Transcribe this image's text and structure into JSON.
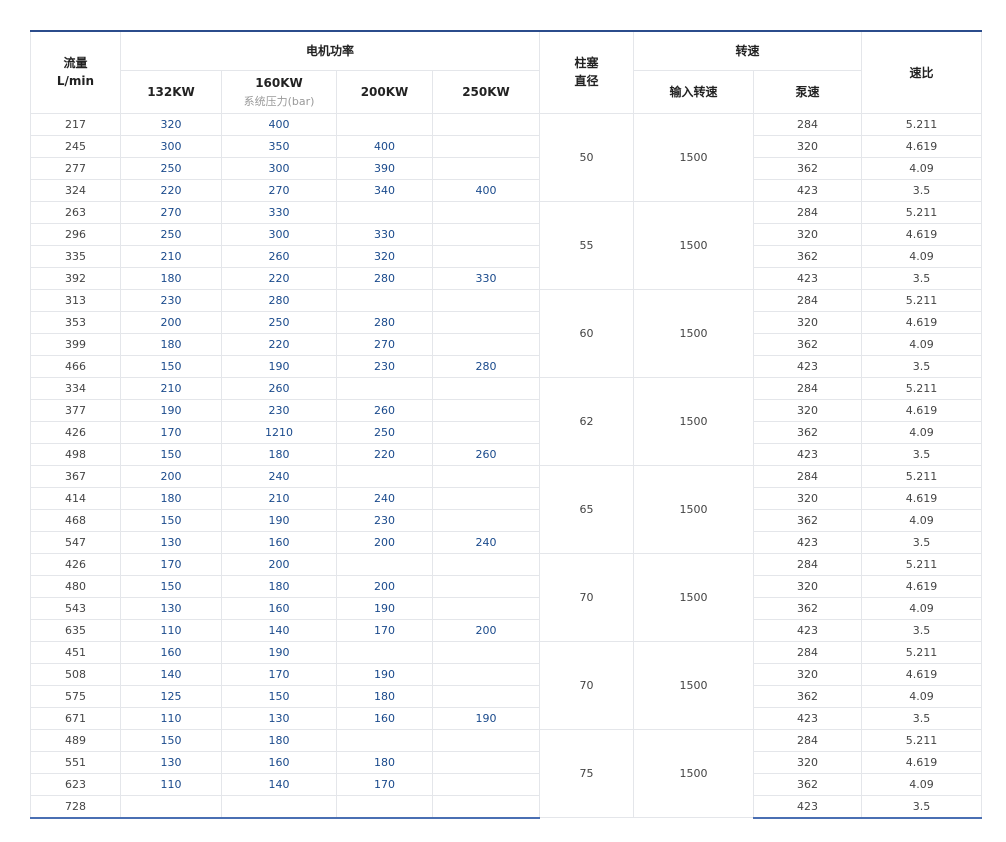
{
  "header": {
    "flow_label": "流量",
    "flow_unit": "L/min",
    "motor_power": "电机功率",
    "power_columns": [
      "132KW",
      "160KW",
      "200KW",
      "250KW"
    ],
    "pressure_caption": "系统压力(bar)",
    "plunger_label": "柱塞",
    "diameter_label": "直径",
    "speed_label": "转速",
    "input_speed": "输入转速",
    "pump_speed": "泵速",
    "ratio_label": "速比"
  },
  "groups": [
    {
      "diameter": "50",
      "input_speed": "1500",
      "rows": [
        {
          "flow": "217",
          "p132": "320",
          "p160": "400",
          "p200": "",
          "p250": "",
          "pump": "284",
          "ratio": "5.211"
        },
        {
          "flow": "245",
          "p132": "300",
          "p160": "350",
          "p200": "400",
          "p250": "",
          "pump": "320",
          "ratio": "4.619"
        },
        {
          "flow": "277",
          "p132": "250",
          "p160": "300",
          "p200": "390",
          "p250": "",
          "pump": "362",
          "ratio": "4.09"
        },
        {
          "flow": "324",
          "p132": "220",
          "p160": "270",
          "p200": "340",
          "p250": "400",
          "pump": "423",
          "ratio": "3.5"
        }
      ]
    },
    {
      "diameter": "55",
      "input_speed": "1500",
      "rows": [
        {
          "flow": "263",
          "p132": "270",
          "p160": "330",
          "p200": "",
          "p250": "",
          "pump": "284",
          "ratio": "5.211"
        },
        {
          "flow": "296",
          "p132": "250",
          "p160": "300",
          "p200": "330",
          "p250": "",
          "pump": "320",
          "ratio": "4.619"
        },
        {
          "flow": "335",
          "p132": "210",
          "p160": "260",
          "p200": "320",
          "p250": "",
          "pump": "362",
          "ratio": "4.09"
        },
        {
          "flow": "392",
          "p132": "180",
          "p160": "220",
          "p200": "280",
          "p250": "330",
          "pump": "423",
          "ratio": "3.5"
        }
      ]
    },
    {
      "diameter": "60",
      "input_speed": "1500",
      "rows": [
        {
          "flow": "313",
          "p132": "230",
          "p160": "280",
          "p200": "",
          "p250": "",
          "pump": "284",
          "ratio": "5.211"
        },
        {
          "flow": "353",
          "p132": "200",
          "p160": "250",
          "p200": "280",
          "p250": "",
          "pump": "320",
          "ratio": "4.619"
        },
        {
          "flow": "399",
          "p132": "180",
          "p160": "220",
          "p200": "270",
          "p250": "",
          "pump": "362",
          "ratio": "4.09"
        },
        {
          "flow": "466",
          "p132": "150",
          "p160": "190",
          "p200": "230",
          "p250": "280",
          "pump": "423",
          "ratio": "3.5"
        }
      ]
    },
    {
      "diameter": "62",
      "input_speed": "1500",
      "rows": [
        {
          "flow": "334",
          "p132": "210",
          "p160": "260",
          "p200": "",
          "p250": "",
          "pump": "284",
          "ratio": "5.211"
        },
        {
          "flow": "377",
          "p132": "190",
          "p160": "230",
          "p200": "260",
          "p250": "",
          "pump": "320",
          "ratio": "4.619"
        },
        {
          "flow": "426",
          "p132": "170",
          "p160": "1210",
          "p200": "250",
          "p250": "",
          "pump": "362",
          "ratio": "4.09"
        },
        {
          "flow": "498",
          "p132": "150",
          "p160": "180",
          "p200": "220",
          "p250": "260",
          "pump": "423",
          "ratio": "3.5"
        }
      ]
    },
    {
      "diameter": "65",
      "input_speed": "1500",
      "rows": [
        {
          "flow": "367",
          "p132": "200",
          "p160": "240",
          "p200": "",
          "p250": "",
          "pump": "284",
          "ratio": "5.211"
        },
        {
          "flow": "414",
          "p132": "180",
          "p160": "210",
          "p200": "240",
          "p250": "",
          "pump": "320",
          "ratio": "4.619"
        },
        {
          "flow": "468",
          "p132": "150",
          "p160": "190",
          "p200": "230",
          "p250": "",
          "pump": "362",
          "ratio": "4.09"
        },
        {
          "flow": "547",
          "p132": "130",
          "p160": "160",
          "p200": "200",
          "p250": "240",
          "pump": "423",
          "ratio": "3.5"
        }
      ]
    },
    {
      "diameter": "70",
      "input_speed": "1500",
      "rows": [
        {
          "flow": "426",
          "p132": "170",
          "p160": "200",
          "p200": "",
          "p250": "",
          "pump": "284",
          "ratio": "5.211"
        },
        {
          "flow": "480",
          "p132": "150",
          "p160": "180",
          "p200": "200",
          "p250": "",
          "pump": "320",
          "ratio": "4.619"
        },
        {
          "flow": "543",
          "p132": "130",
          "p160": "160",
          "p200": "190",
          "p250": "",
          "pump": "362",
          "ratio": "4.09"
        },
        {
          "flow": "635",
          "p132": "110",
          "p160": "140",
          "p200": "170",
          "p250": "200",
          "pump": "423",
          "ratio": "3.5"
        }
      ]
    },
    {
      "diameter": "70",
      "input_speed": "1500",
      "rows": [
        {
          "flow": "451",
          "p132": "160",
          "p160": "190",
          "p200": "",
          "p250": "",
          "pump": "284",
          "ratio": "5.211"
        },
        {
          "flow": "508",
          "p132": "140",
          "p160": "170",
          "p200": "190",
          "p250": "",
          "pump": "320",
          "ratio": "4.619"
        },
        {
          "flow": "575",
          "p132": "125",
          "p160": "150",
          "p200": "180",
          "p250": "",
          "pump": "362",
          "ratio": "4.09"
        },
        {
          "flow": "671",
          "p132": "110",
          "p160": "130",
          "p200": "160",
          "p250": "190",
          "pump": "423",
          "ratio": "3.5"
        }
      ]
    },
    {
      "diameter": "75",
      "input_speed": "1500",
      "rows": [
        {
          "flow": "489",
          "p132": "150",
          "p160": "180",
          "p200": "",
          "p250": "",
          "pump": "284",
          "ratio": "5.211"
        },
        {
          "flow": "551",
          "p132": "130",
          "p160": "160",
          "p200": "180",
          "p250": "",
          "pump": "320",
          "ratio": "4.619"
        },
        {
          "flow": "623",
          "p132": "110",
          "p160": "140",
          "p200": "170",
          "p250": "",
          "pump": "362",
          "ratio": "4.09"
        },
        {
          "flow": "728",
          "p132": "",
          "p160": "",
          "p200": "",
          "p250": "",
          "pump": "423",
          "ratio": "3.5"
        }
      ]
    }
  ]
}
